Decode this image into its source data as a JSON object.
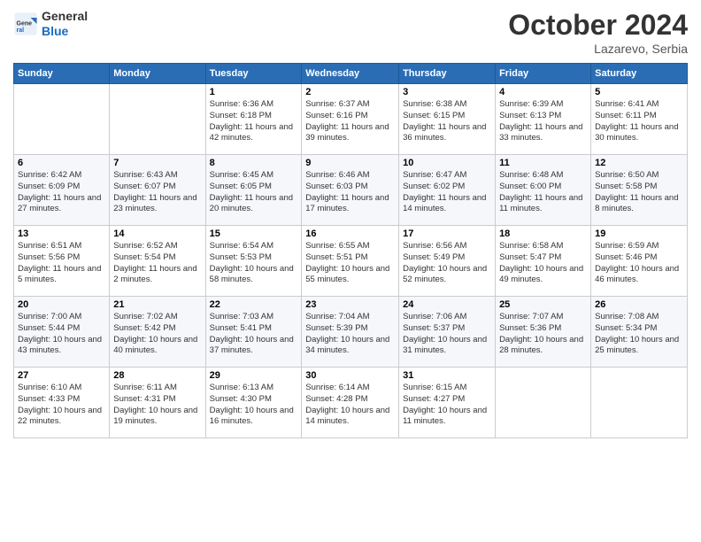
{
  "header": {
    "logo_general": "General",
    "logo_blue": "Blue",
    "month": "October 2024",
    "location": "Lazarevo, Serbia"
  },
  "weekdays": [
    "Sunday",
    "Monday",
    "Tuesday",
    "Wednesday",
    "Thursday",
    "Friday",
    "Saturday"
  ],
  "weeks": [
    [
      {
        "day": null
      },
      {
        "day": null
      },
      {
        "day": "1",
        "sunrise": "6:36 AM",
        "sunset": "6:18 PM",
        "daylight": "11 hours and 42 minutes."
      },
      {
        "day": "2",
        "sunrise": "6:37 AM",
        "sunset": "6:16 PM",
        "daylight": "11 hours and 39 minutes."
      },
      {
        "day": "3",
        "sunrise": "6:38 AM",
        "sunset": "6:15 PM",
        "daylight": "11 hours and 36 minutes."
      },
      {
        "day": "4",
        "sunrise": "6:39 AM",
        "sunset": "6:13 PM",
        "daylight": "11 hours and 33 minutes."
      },
      {
        "day": "5",
        "sunrise": "6:41 AM",
        "sunset": "6:11 PM",
        "daylight": "11 hours and 30 minutes."
      }
    ],
    [
      {
        "day": "6",
        "sunrise": "6:42 AM",
        "sunset": "6:09 PM",
        "daylight": "11 hours and 27 minutes."
      },
      {
        "day": "7",
        "sunrise": "6:43 AM",
        "sunset": "6:07 PM",
        "daylight": "11 hours and 23 minutes."
      },
      {
        "day": "8",
        "sunrise": "6:45 AM",
        "sunset": "6:05 PM",
        "daylight": "11 hours and 20 minutes."
      },
      {
        "day": "9",
        "sunrise": "6:46 AM",
        "sunset": "6:03 PM",
        "daylight": "11 hours and 17 minutes."
      },
      {
        "day": "10",
        "sunrise": "6:47 AM",
        "sunset": "6:02 PM",
        "daylight": "11 hours and 14 minutes."
      },
      {
        "day": "11",
        "sunrise": "6:48 AM",
        "sunset": "6:00 PM",
        "daylight": "11 hours and 11 minutes."
      },
      {
        "day": "12",
        "sunrise": "6:50 AM",
        "sunset": "5:58 PM",
        "daylight": "11 hours and 8 minutes."
      }
    ],
    [
      {
        "day": "13",
        "sunrise": "6:51 AM",
        "sunset": "5:56 PM",
        "daylight": "11 hours and 5 minutes."
      },
      {
        "day": "14",
        "sunrise": "6:52 AM",
        "sunset": "5:54 PM",
        "daylight": "11 hours and 2 minutes."
      },
      {
        "day": "15",
        "sunrise": "6:54 AM",
        "sunset": "5:53 PM",
        "daylight": "10 hours and 58 minutes."
      },
      {
        "day": "16",
        "sunrise": "6:55 AM",
        "sunset": "5:51 PM",
        "daylight": "10 hours and 55 minutes."
      },
      {
        "day": "17",
        "sunrise": "6:56 AM",
        "sunset": "5:49 PM",
        "daylight": "10 hours and 52 minutes."
      },
      {
        "day": "18",
        "sunrise": "6:58 AM",
        "sunset": "5:47 PM",
        "daylight": "10 hours and 49 minutes."
      },
      {
        "day": "19",
        "sunrise": "6:59 AM",
        "sunset": "5:46 PM",
        "daylight": "10 hours and 46 minutes."
      }
    ],
    [
      {
        "day": "20",
        "sunrise": "7:00 AM",
        "sunset": "5:44 PM",
        "daylight": "10 hours and 43 minutes."
      },
      {
        "day": "21",
        "sunrise": "7:02 AM",
        "sunset": "5:42 PM",
        "daylight": "10 hours and 40 minutes."
      },
      {
        "day": "22",
        "sunrise": "7:03 AM",
        "sunset": "5:41 PM",
        "daylight": "10 hours and 37 minutes."
      },
      {
        "day": "23",
        "sunrise": "7:04 AM",
        "sunset": "5:39 PM",
        "daylight": "10 hours and 34 minutes."
      },
      {
        "day": "24",
        "sunrise": "7:06 AM",
        "sunset": "5:37 PM",
        "daylight": "10 hours and 31 minutes."
      },
      {
        "day": "25",
        "sunrise": "7:07 AM",
        "sunset": "5:36 PM",
        "daylight": "10 hours and 28 minutes."
      },
      {
        "day": "26",
        "sunrise": "7:08 AM",
        "sunset": "5:34 PM",
        "daylight": "10 hours and 25 minutes."
      }
    ],
    [
      {
        "day": "27",
        "sunrise": "6:10 AM",
        "sunset": "4:33 PM",
        "daylight": "10 hours and 22 minutes."
      },
      {
        "day": "28",
        "sunrise": "6:11 AM",
        "sunset": "4:31 PM",
        "daylight": "10 hours and 19 minutes."
      },
      {
        "day": "29",
        "sunrise": "6:13 AM",
        "sunset": "4:30 PM",
        "daylight": "10 hours and 16 minutes."
      },
      {
        "day": "30",
        "sunrise": "6:14 AM",
        "sunset": "4:28 PM",
        "daylight": "10 hours and 14 minutes."
      },
      {
        "day": "31",
        "sunrise": "6:15 AM",
        "sunset": "4:27 PM",
        "daylight": "10 hours and 11 minutes."
      },
      {
        "day": null
      },
      {
        "day": null
      }
    ]
  ]
}
